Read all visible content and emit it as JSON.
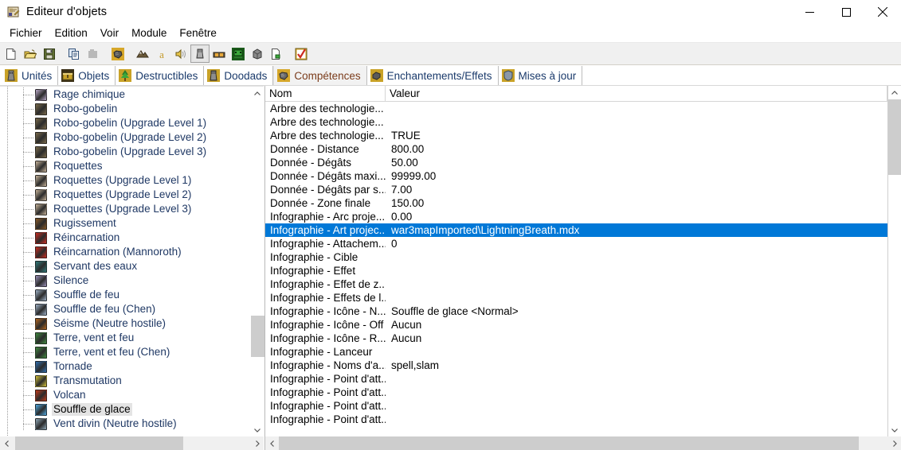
{
  "window": {
    "title": "Editeur d'objets",
    "icon": "object-editor-icon",
    "minimize_label": "—",
    "maximize_label": "□",
    "close_label": "✕"
  },
  "menu": {
    "items": [
      {
        "label": "Fichier"
      },
      {
        "label": "Edition"
      },
      {
        "label": "Voir"
      },
      {
        "label": "Module"
      },
      {
        "label": "Fenêtre"
      }
    ]
  },
  "toolbar": {
    "buttons": [
      {
        "name": "new-icon",
        "group": 0,
        "pressed": false
      },
      {
        "name": "open-icon",
        "group": 0,
        "pressed": false
      },
      {
        "name": "save-icon",
        "group": 0,
        "pressed": false
      },
      {
        "name": "copy-icon",
        "group": 1,
        "pressed": false
      },
      {
        "name": "paste-icon",
        "group": 1,
        "pressed": false
      },
      {
        "name": "abilities-module-icon",
        "group": 2,
        "pressed": false
      },
      {
        "name": "terrain-editor-icon",
        "group": 3,
        "pressed": false
      },
      {
        "name": "trigger-editor-icon",
        "group": 3,
        "pressed": false
      },
      {
        "name": "sound-editor-icon",
        "group": 3,
        "pressed": false
      },
      {
        "name": "object-editor-icon",
        "group": 3,
        "pressed": true
      },
      {
        "name": "campaign-editor-icon",
        "group": 3,
        "pressed": false
      },
      {
        "name": "ai-editor-icon",
        "group": 3,
        "pressed": false
      },
      {
        "name": "object-manager-icon",
        "group": 3,
        "pressed": false
      },
      {
        "name": "import-manager-icon",
        "group": 3,
        "pressed": false
      },
      {
        "name": "test-map-icon",
        "group": 4,
        "pressed": false
      }
    ]
  },
  "tabs": [
    {
      "label": "Unités",
      "icon": "unit-icon",
      "active": false
    },
    {
      "label": "Objets",
      "icon": "item-icon",
      "active": false
    },
    {
      "label": "Destructibles",
      "icon": "destructible-icon",
      "active": false
    },
    {
      "label": "Doodads",
      "icon": "doodad-icon",
      "active": false
    },
    {
      "label": "Compétences",
      "icon": "ability-icon",
      "active": true
    },
    {
      "label": "Enchantements/Effets",
      "icon": "buff-icon",
      "active": false
    },
    {
      "label": "Mises à jour",
      "icon": "upgrade-icon",
      "active": false
    }
  ],
  "tree": {
    "items": [
      {
        "label": "Rage chimique",
        "icon_color": "#b9a8c8",
        "selected": false
      },
      {
        "label": "Robo-gobelin",
        "icon_color": "#7a6a4a",
        "selected": false
      },
      {
        "label": "Robo-gobelin (Upgrade Level 1)",
        "icon_color": "#7a6a4a",
        "selected": false
      },
      {
        "label": "Robo-gobelin (Upgrade Level 2)",
        "icon_color": "#7a6a4a",
        "selected": false
      },
      {
        "label": "Robo-gobelin (Upgrade Level 3)",
        "icon_color": "#7a6a4a",
        "selected": false
      },
      {
        "label": "Roquettes",
        "icon_color": "#c8b49a",
        "selected": false
      },
      {
        "label": "Roquettes (Upgrade Level 1)",
        "icon_color": "#c8b49a",
        "selected": false
      },
      {
        "label": "Roquettes (Upgrade Level 2)",
        "icon_color": "#c8b49a",
        "selected": false
      },
      {
        "label": "Roquettes (Upgrade Level 3)",
        "icon_color": "#c8b49a",
        "selected": false
      },
      {
        "label": "Rugissement",
        "icon_color": "#8a5a28",
        "selected": false
      },
      {
        "label": "Réincarnation",
        "icon_color": "#cc2b20",
        "selected": false
      },
      {
        "label": "Réincarnation (Mannoroth)",
        "icon_color": "#cc2b20",
        "selected": false
      },
      {
        "label": "Servant des eaux",
        "icon_color": "#2f7a7a",
        "selected": false
      },
      {
        "label": "Silence",
        "icon_color": "#9a90b8",
        "selected": false
      },
      {
        "label": "Souffle de feu",
        "icon_color": "#9fb2c8",
        "selected": false
      },
      {
        "label": "Souffle de feu (Chen)",
        "icon_color": "#9fb2c8",
        "selected": false
      },
      {
        "label": "Séisme (Neutre hostile)",
        "icon_color": "#b3661f",
        "selected": false
      },
      {
        "label": "Terre, vent et feu",
        "icon_color": "#3f8a3f",
        "selected": false
      },
      {
        "label": "Terre, vent et feu (Chen)",
        "icon_color": "#3f8a3f",
        "selected": false
      },
      {
        "label": "Tornade",
        "icon_color": "#2f6fb0",
        "selected": false
      },
      {
        "label": "Transmutation",
        "icon_color": "#d6c43a",
        "selected": false
      },
      {
        "label": "Volcan",
        "icon_color": "#c23a1a",
        "selected": false
      },
      {
        "label": "Souffle de glace",
        "icon_color": "#4fa8e0",
        "selected": true
      },
      {
        "label": "Vent divin (Neutre hostile)",
        "icon_color": "#8fa8b8",
        "selected": false
      }
    ]
  },
  "properties": {
    "columns": {
      "name": "Nom",
      "value": "Valeur"
    },
    "rows": [
      {
        "name": "Arbre des technologie...",
        "value": "",
        "selected": false
      },
      {
        "name": "Arbre des technologie...",
        "value": "",
        "selected": false
      },
      {
        "name": "Arbre des technologie...",
        "value": "TRUE",
        "selected": false
      },
      {
        "name": "Donnée - Distance",
        "value": "800.00",
        "selected": false
      },
      {
        "name": "Donnée - Dégâts",
        "value": "50.00",
        "selected": false
      },
      {
        "name": "Donnée - Dégâts maxi...",
        "value": "99999.00",
        "selected": false
      },
      {
        "name": "Donnée - Dégâts par s...",
        "value": "7.00",
        "selected": false
      },
      {
        "name": "Donnée - Zone finale",
        "value": "150.00",
        "selected": false
      },
      {
        "name": "Infographie - Arc proje...",
        "value": "0.00",
        "selected": false
      },
      {
        "name": "Infographie - Art projec...",
        "value": "war3mapImported\\LightningBreath.mdx",
        "selected": true
      },
      {
        "name": "Infographie - Attachem...",
        "value": "0",
        "selected": false
      },
      {
        "name": "Infographie - Cible",
        "value": "",
        "selected": false
      },
      {
        "name": "Infographie - Effet",
        "value": "",
        "selected": false
      },
      {
        "name": "Infographie - Effet de z...",
        "value": "",
        "selected": false
      },
      {
        "name": "Infographie - Effets de l...",
        "value": "",
        "selected": false
      },
      {
        "name": "Infographie - Icône - N...",
        "value": "Souffle de glace <Normal>",
        "selected": false
      },
      {
        "name": "Infographie - Icône - Off",
        "value": "Aucun",
        "selected": false
      },
      {
        "name": "Infographie - Icône - R...",
        "value": "Aucun",
        "selected": false
      },
      {
        "name": "Infographie - Lanceur",
        "value": "",
        "selected": false
      },
      {
        "name": "Infographie - Noms d'a...",
        "value": "spell,slam",
        "selected": false
      },
      {
        "name": "Infographie - Point d'att...",
        "value": "",
        "selected": false
      },
      {
        "name": "Infographie - Point d'att...",
        "value": "",
        "selected": false
      },
      {
        "name": "Infographie - Point d'att...",
        "value": "",
        "selected": false
      },
      {
        "name": "Infographie - Point d'att...",
        "value": "",
        "selected": false
      }
    ]
  },
  "colors": {
    "selection_blue": "#0078d7",
    "selection_gray": "#e4e4e4",
    "tree_text": "#1f3864",
    "scrollbar_thumb": "#cdcdcd",
    "toolbar_bg": "#f0f0f0"
  }
}
